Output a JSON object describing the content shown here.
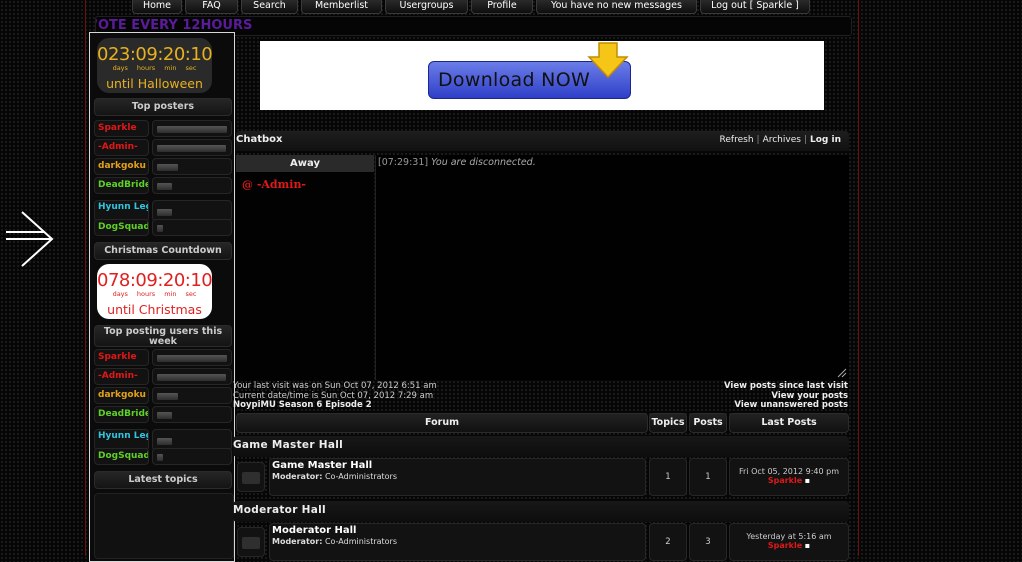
{
  "nav": [
    "Home",
    "FAQ",
    "Search",
    "Memberlist",
    "Usergroups",
    "Profile",
    "You have no new messages",
    "Log out [ Sparkle ]"
  ],
  "marquee": "'OTE EVERY 12HOURS",
  "halloween": {
    "time": "023:09:20:10",
    "units": [
      "days",
      "hours",
      "min",
      "sec"
    ],
    "until": "until Halloween"
  },
  "christmas": {
    "time": "078:09:20:10",
    "units": [
      "days",
      "hours",
      "min",
      "sec"
    ],
    "until": "until Christmas"
  },
  "top_posters": {
    "title": "Top posters",
    "users": [
      {
        "name": "Sparkle",
        "color": "#e01818",
        "level": 1.0
      },
      {
        "name": "-Admin-",
        "color": "#e01818",
        "level": 0.98
      },
      {
        "name": "darkgoku",
        "color": "#e3a11a",
        "level": 0.3
      },
      {
        "name": "DeadBride",
        "color": "#5fd028",
        "level": 0.22
      },
      {
        "name": "Hyunn Leg",
        "color": "#30c4e0",
        "level": 0.22
      },
      {
        "name": "DogSquad",
        "color": "#5fd028",
        "level": 0.08
      }
    ]
  },
  "christmas_head": "Christmas Countdown",
  "top_week": {
    "title": "Top posting users this week",
    "users": [
      {
        "name": "Sparkle",
        "color": "#e01818",
        "level": 1.0
      },
      {
        "name": "-Admin-",
        "color": "#e01818",
        "level": 0.98
      },
      {
        "name": "darkgoku",
        "color": "#e3a11a",
        "level": 0.3
      },
      {
        "name": "DeadBride",
        "color": "#5fd028",
        "level": 0.22
      },
      {
        "name": "Hyunn Leg",
        "color": "#30c4e0",
        "level": 0.22
      },
      {
        "name": "DogSquad",
        "color": "#5fd028",
        "level": 0.08
      }
    ]
  },
  "latest_topics": "Latest topics",
  "banner": {
    "button": "Download NOW"
  },
  "chatbox": {
    "title": "Chatbox",
    "links": {
      "refresh": "Refresh",
      "archives": "Archives",
      "login": "Log in"
    },
    "away": "Away",
    "away_user": "@ -Admin-",
    "message_time": "[07:29:31]",
    "message_text": "You are disconnected."
  },
  "info": {
    "last_visit": "Your last visit was on Sun Oct 07, 2012 6:51 am",
    "current": "Current date/time is Sun Oct 07, 2012 7:29 am",
    "episode": "NoypiMU Season 6 Episode 2",
    "links": [
      "View posts since last visit",
      "View your posts",
      "View unanswered posts"
    ]
  },
  "forum_headers": {
    "forum": "Forum",
    "topics": "Topics",
    "posts": "Posts",
    "last": "Last Posts"
  },
  "categories": [
    {
      "name": "Game Master Hall",
      "forum": "Game Master Hall",
      "moderator_label": "Moderator:",
      "moderator": "Co-Administrators",
      "topics": "1",
      "posts": "1",
      "last_date": "Fri Oct 05, 2012 9:40 pm",
      "last_user": "Sparkle"
    },
    {
      "name": "Moderator Hall",
      "forum": "Moderator Hall",
      "moderator_label": "Moderator:",
      "moderator": "Co-Administrators",
      "topics": "2",
      "posts": "3",
      "last_date": "Yesterday at 5:16 am",
      "last_user": "Sparkle"
    }
  ]
}
